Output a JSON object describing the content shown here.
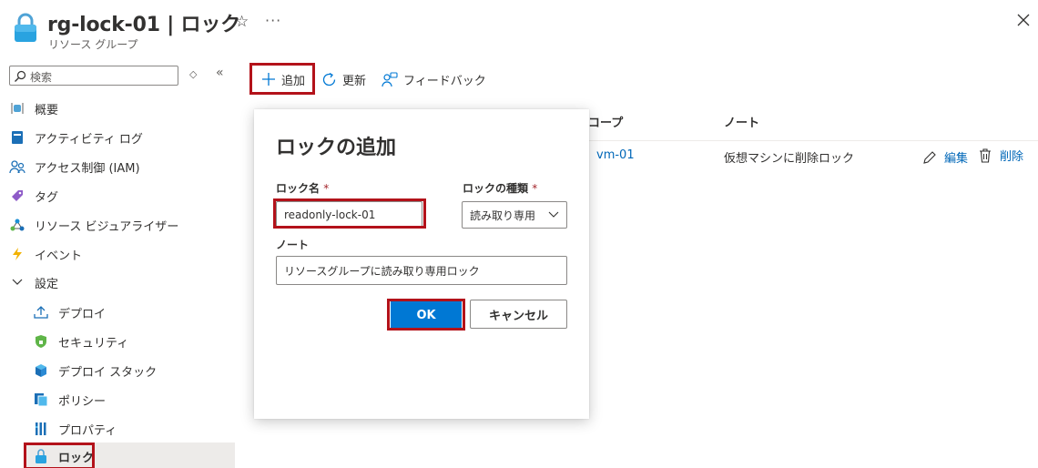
{
  "header": {
    "title": "rg-lock-01 | ロック",
    "subtitle": "リソース グループ",
    "star_glyph": "☆",
    "more_glyph": "···"
  },
  "sidebar": {
    "search_placeholder": "検索",
    "sort_glyph": "◇",
    "collapse_glyph": "«",
    "items": [
      {
        "label": "概要",
        "icon": "overview-icon"
      },
      {
        "label": "アクティビティ ログ",
        "icon": "activity-log-icon"
      },
      {
        "label": "アクセス制御 (IAM)",
        "icon": "iam-icon"
      },
      {
        "label": "タグ",
        "icon": "tag-icon"
      },
      {
        "label": "リソース ビジュアライザー",
        "icon": "visualizer-icon"
      },
      {
        "label": "イベント",
        "icon": "events-icon"
      }
    ],
    "settings_group": {
      "label": "設定",
      "icon": "chevron-down-icon"
    },
    "settings_items": [
      {
        "label": "デプロイ",
        "icon": "deploy-icon"
      },
      {
        "label": "セキュリティ",
        "icon": "security-icon"
      },
      {
        "label": "デプロイ スタック",
        "icon": "deployment-stack-icon"
      },
      {
        "label": "ポリシー",
        "icon": "policy-icon"
      },
      {
        "label": "プロパティ",
        "icon": "properties-icon"
      },
      {
        "label": "ロック",
        "icon": "lock-icon",
        "selected": true
      }
    ]
  },
  "toolbar": {
    "add_label": "追加",
    "refresh_label": "更新",
    "feedback_label": "フィードバック"
  },
  "table": {
    "columns": [
      "コープ",
      "ノート"
    ],
    "rows": [
      {
        "scope": "vm-01",
        "note": "仮想マシンに削除ロック",
        "edit_label": "編集",
        "delete_label": "削除"
      }
    ]
  },
  "dialog": {
    "title": "ロックの追加",
    "name_label": "ロック名",
    "name_value": "readonly-lock-01",
    "type_label": "ロックの種類",
    "type_value": "読み取り専用",
    "required_mark": "*",
    "note_label": "ノート",
    "note_value": "リソースグループに読み取り専用ロック",
    "ok_label": "OK",
    "cancel_label": "キャンセル"
  },
  "colors": {
    "accent": "#0078d4",
    "link": "#0067b8",
    "highlight_frame": "#b3121a"
  }
}
